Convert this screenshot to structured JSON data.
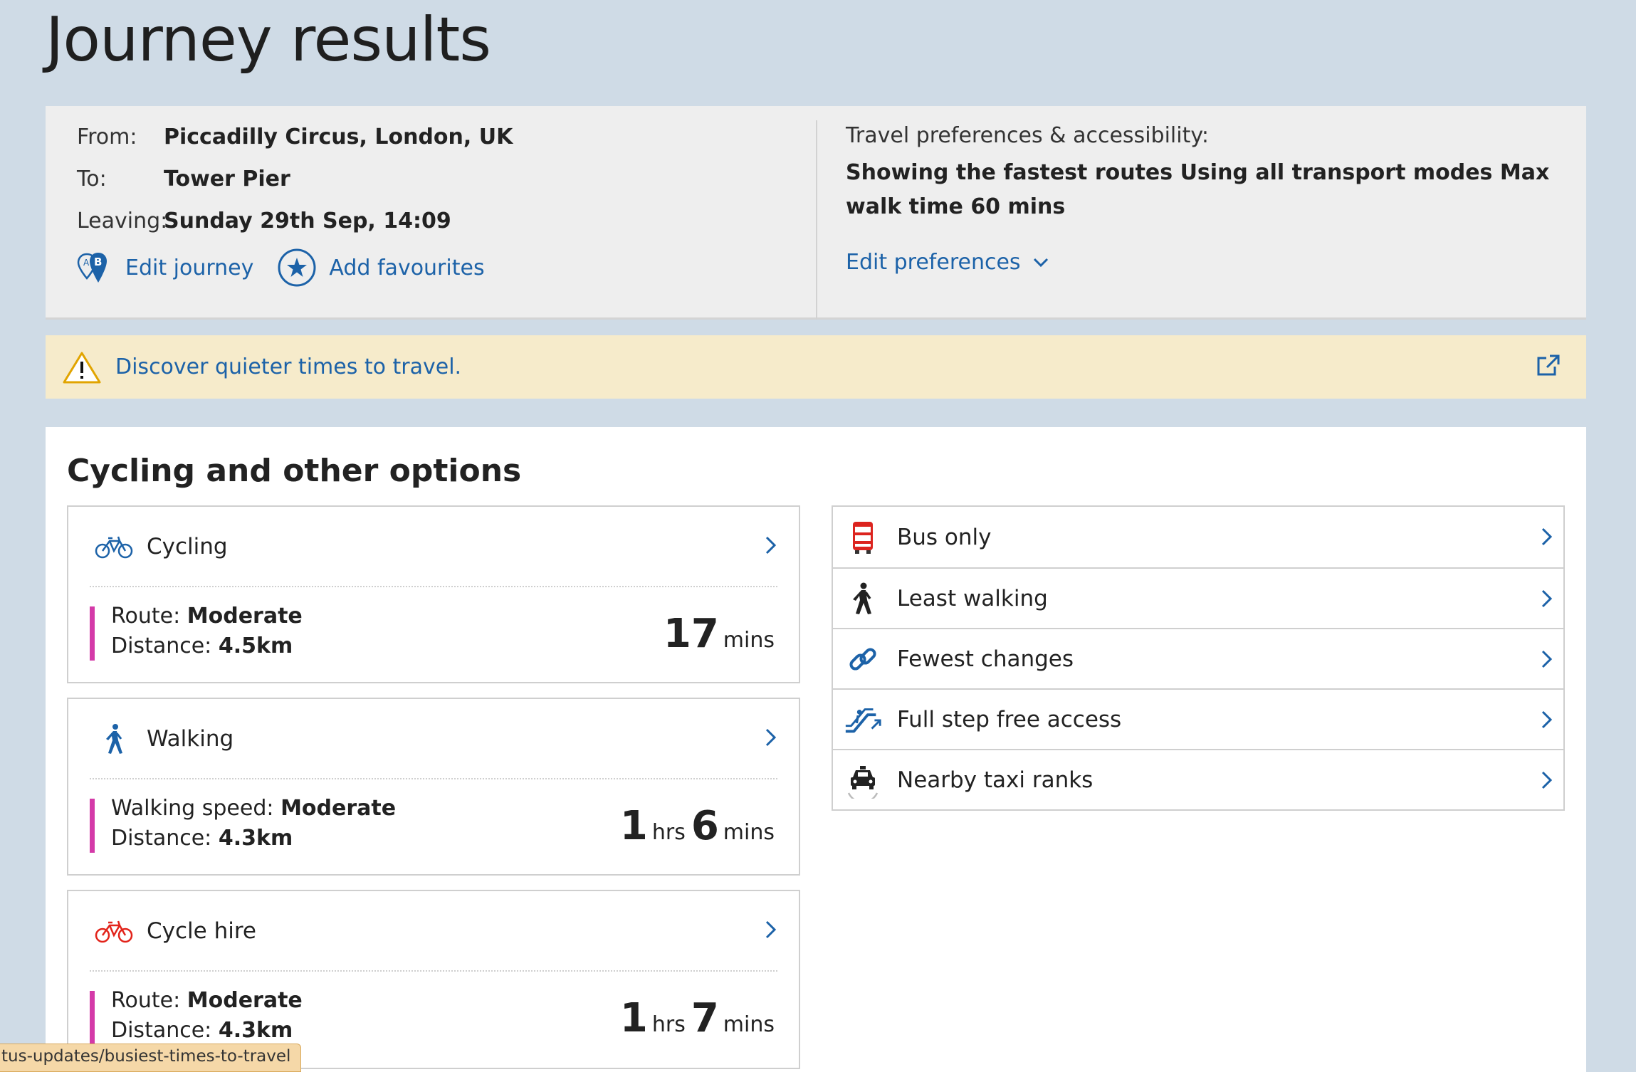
{
  "page": {
    "title": "Journey results"
  },
  "summary": {
    "from_label": "From:",
    "from_value": "Piccadilly Circus, London, UK",
    "to_label": "To:",
    "to_value": "Tower Pier",
    "leaving_label": "Leaving:",
    "leaving_value": "Sunday 29th Sep, 14:09",
    "edit_journey": "Edit journey",
    "add_favourites": "Add favourites",
    "prefs_label": "Travel preferences & accessibility:",
    "prefs_value": "Showing the fastest routes Using all transport modes Max walk time 60 mins",
    "edit_preferences": "Edit preferences"
  },
  "alert": {
    "message": "Discover quieter times to travel."
  },
  "options": {
    "title": "Cycling and other options",
    "cards": [
      {
        "name": "Cycling",
        "icon": "bicycle-icon",
        "line1_label": "Route:",
        "line1_value": "Moderate",
        "line2_label": "Distance:",
        "line2_value": "4.5km",
        "dur_mins": "17",
        "mins_unit": "mins"
      },
      {
        "name": "Walking",
        "icon": "walking-person-icon",
        "line1_label": "Walking speed:",
        "line1_value": "Moderate",
        "line2_label": "Distance:",
        "line2_value": "4.3km",
        "dur_hrs": "1",
        "hrs_unit": "hrs",
        "dur_mins": "6",
        "mins_unit": "mins"
      },
      {
        "name": "Cycle hire",
        "icon": "cycle-hire-icon",
        "line1_label": "Route:",
        "line1_value": "Moderate",
        "line2_label": "Distance:",
        "line2_value": "4.3km",
        "dur_hrs": "1",
        "hrs_unit": "hrs",
        "dur_mins": "7",
        "mins_unit": "mins"
      }
    ],
    "list": [
      {
        "name": "Bus only",
        "icon": "bus-icon"
      },
      {
        "name": "Least walking",
        "icon": "walking-person-icon"
      },
      {
        "name": "Fewest changes",
        "icon": "link-icon"
      },
      {
        "name": "Full step free access",
        "icon": "escalator-icon"
      },
      {
        "name": "Nearby taxi ranks",
        "icon": "taxi-icon"
      }
    ]
  },
  "status_bar": {
    "url": "tus-updates/busiest-times-to-travel"
  },
  "colors": {
    "background": "#cfdbe6",
    "link": "#1c62a8",
    "accent_bar": "#d43aa8",
    "alert_bg": "#f6ebcb"
  }
}
